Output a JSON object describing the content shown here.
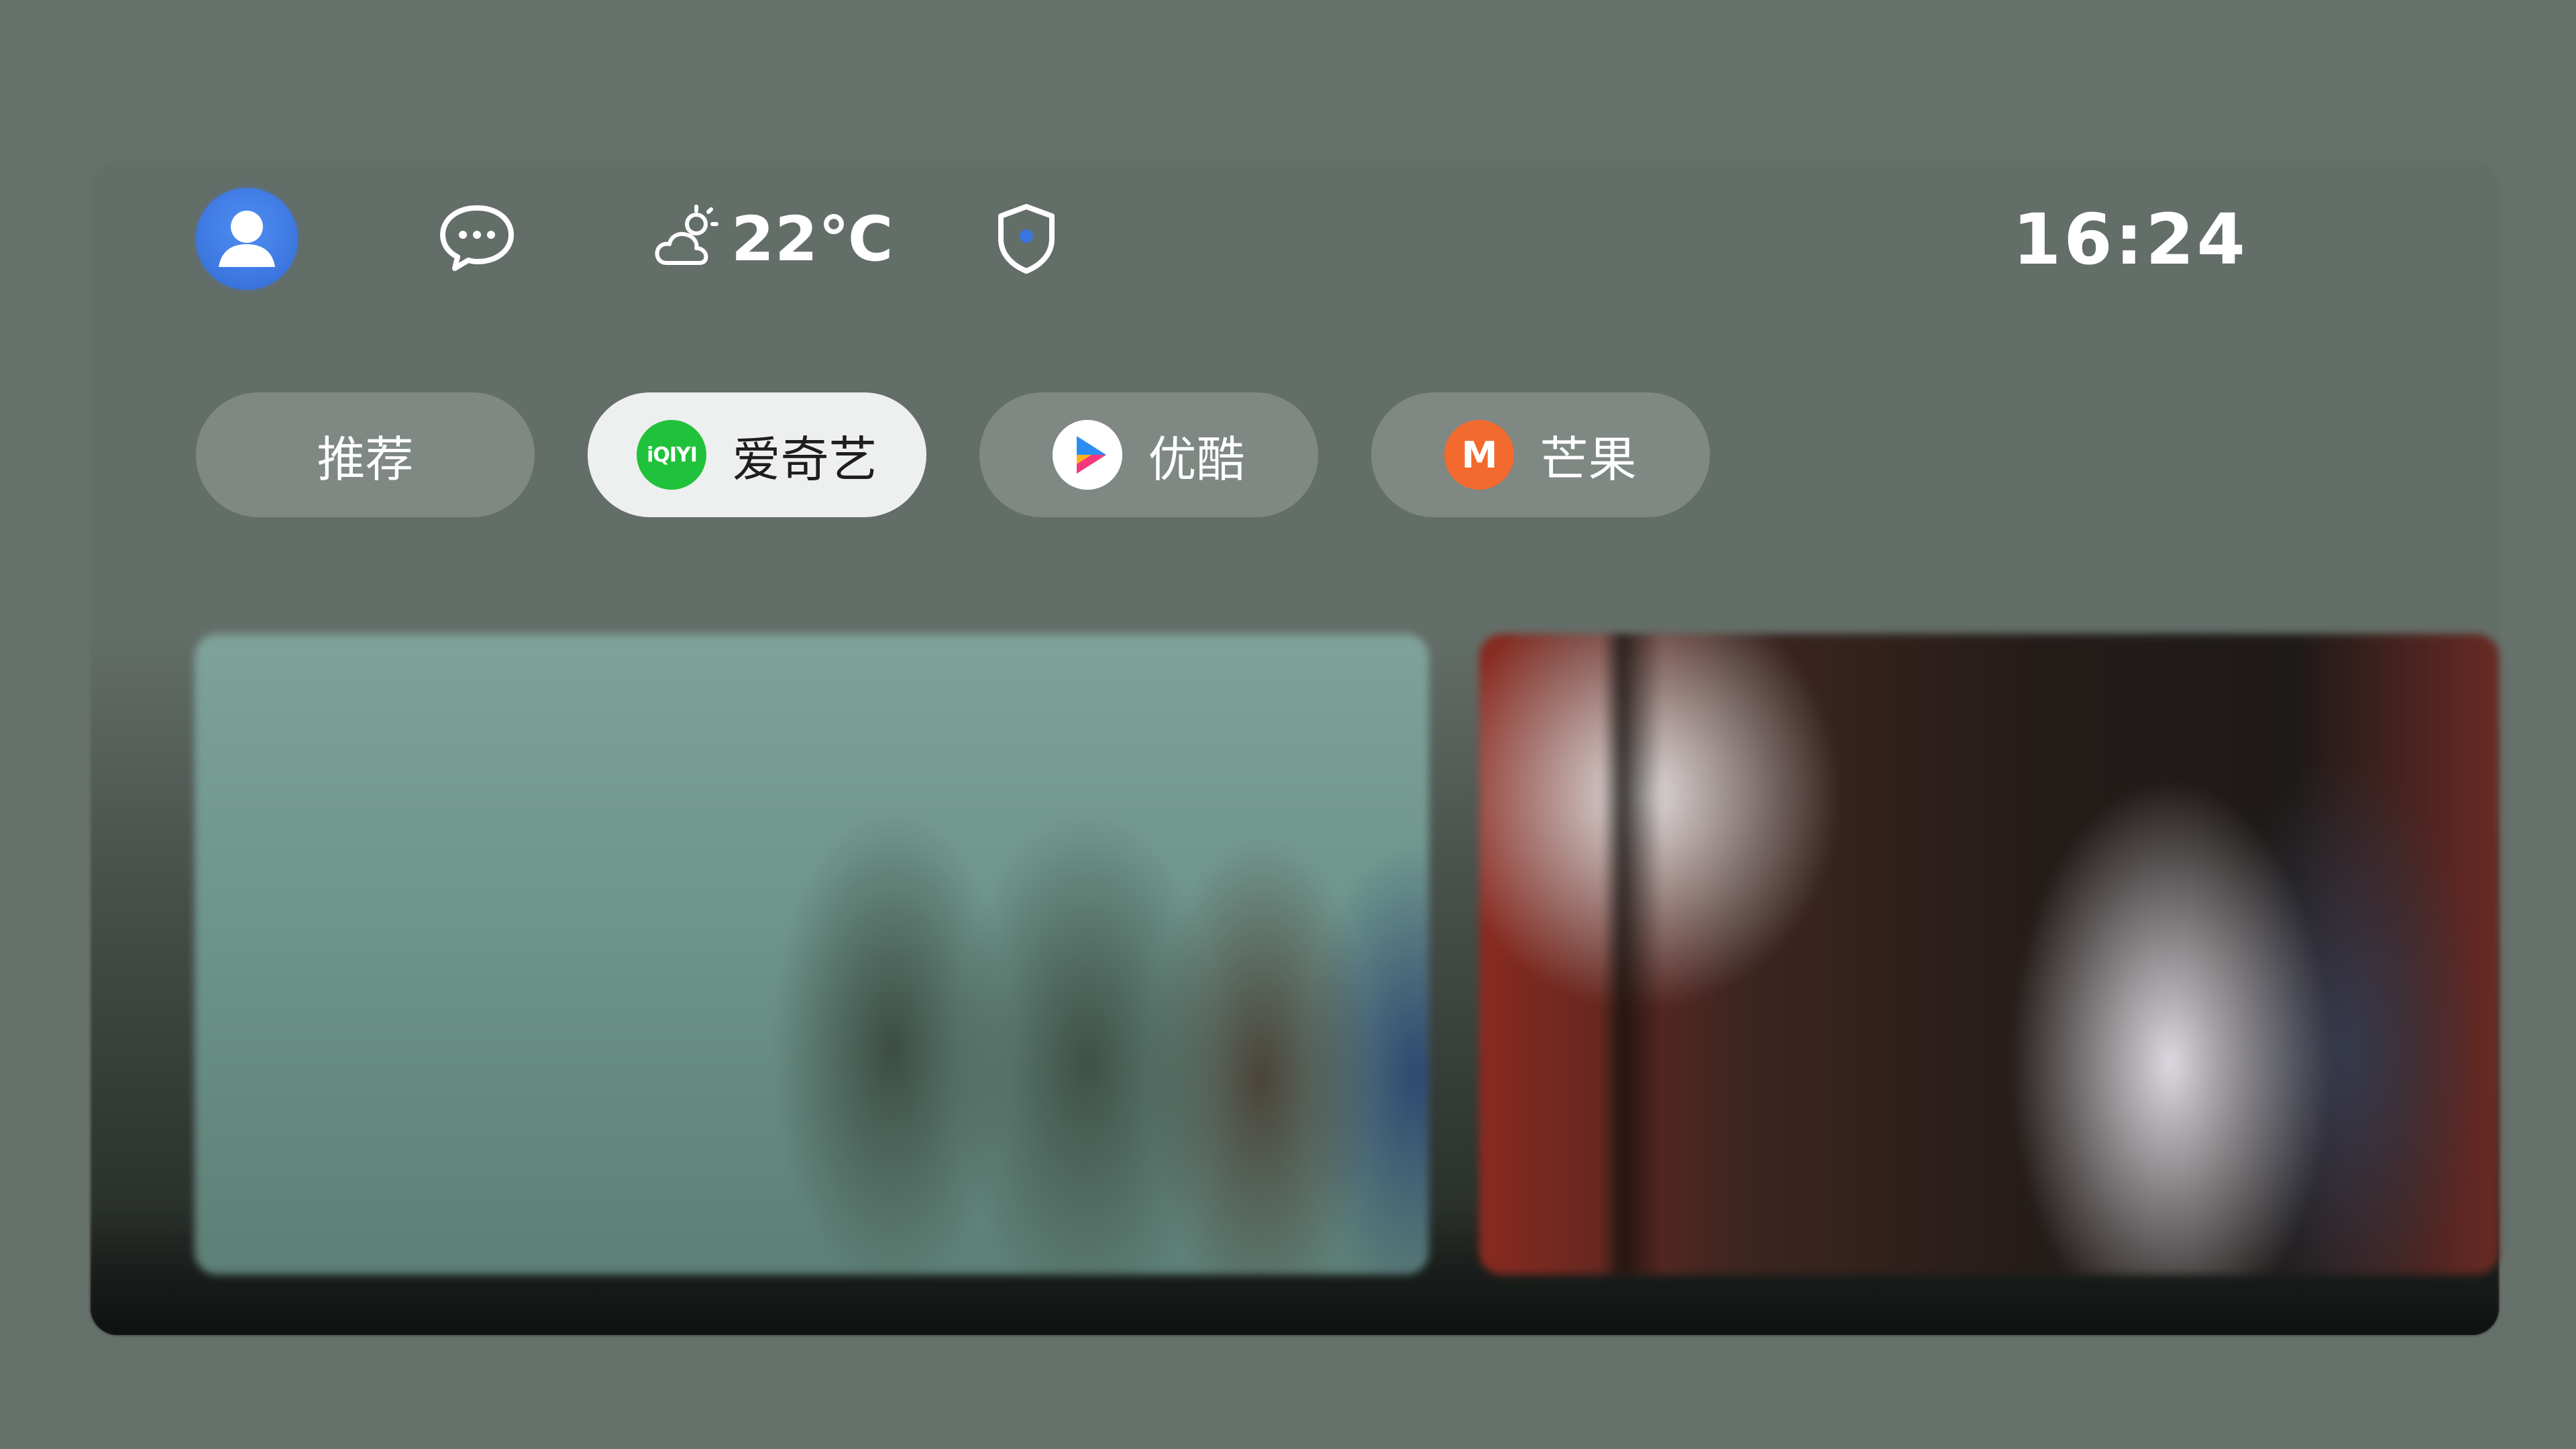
{
  "status_bar": {
    "avatar_icon": "user-avatar-icon",
    "message_icon": "chat-bubble-icon",
    "weather_icon": "partly-cloudy-icon",
    "temperature": "22℃",
    "security_icon": "shield-icon",
    "time": "16:24"
  },
  "tabs": [
    {
      "label": "推荐",
      "selected": false
    },
    {
      "label": "爱奇艺",
      "selected": true,
      "logo_text": "iQIYI",
      "logo_color": "#1fc23a"
    },
    {
      "label": "优酷",
      "selected": false,
      "logo_icon": "youku-play-icon"
    },
    {
      "label": "芒果",
      "selected": false,
      "logo_text": "M",
      "logo_color": "#f26a2e"
    }
  ],
  "cards": [
    {
      "title": ""
    },
    {
      "title": ""
    }
  ],
  "colors": {
    "background": "#67716b",
    "accent_blue": "#3b76df",
    "selected_tab": "#eeefef"
  }
}
